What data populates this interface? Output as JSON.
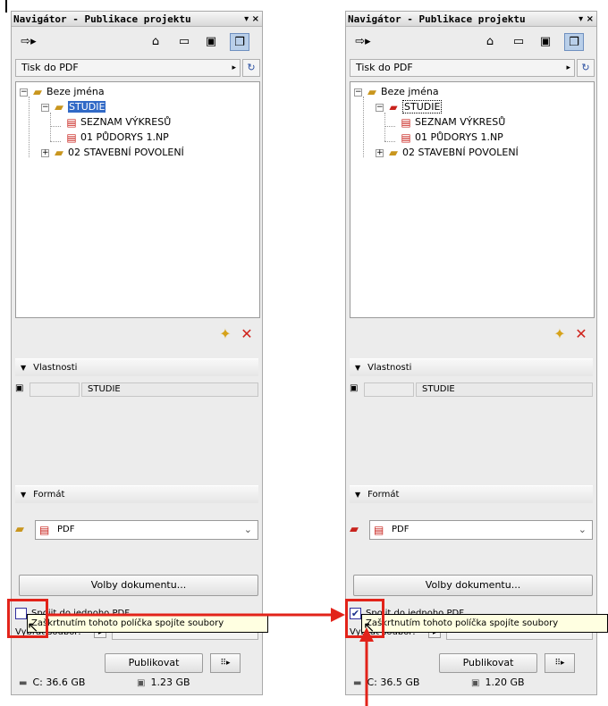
{
  "panel_title": "Navigátor - Publikace projektu",
  "title_controls": "▾ ×",
  "toolbar_icons": [
    "publish-icon",
    "house-icon",
    "folder-icon",
    "layout-icon",
    "publisher-icon"
  ],
  "publisher_set": "Tisk do PDF",
  "tree": {
    "root": "Beze jména",
    "set": "STUDIE",
    "items": [
      "SEZNAM VÝKRESŮ",
      "01 PŮDORYS 1.NP"
    ],
    "other_set": "02 STAVEBNÍ POVOLENÍ"
  },
  "properties_header": "Vlastnosti",
  "property_value": "STUDIE",
  "format_header": "Formát",
  "format_value": "PDF",
  "document_options_button": "Volby dokumentu...",
  "merge_checkbox_label": "Spojit do jednoho PDF",
  "vybrat_label": "Vybrat soubor:",
  "tooltip": "Zaškrtnutím tohoto políčka spojíte soubory",
  "publish_button": "Publikovat",
  "left": {
    "checkbox_checked": false,
    "disk_c": "C: 36.6 GB",
    "memory": "1.23 GB"
  },
  "right": {
    "checkbox_checked": true,
    "disk_c": "C: 36.5 GB",
    "memory": "1.20 GB"
  },
  "colors": {
    "highlight": "#e2231a",
    "selection": "#3169c6",
    "tooltip_bg": "#ffffe1"
  }
}
